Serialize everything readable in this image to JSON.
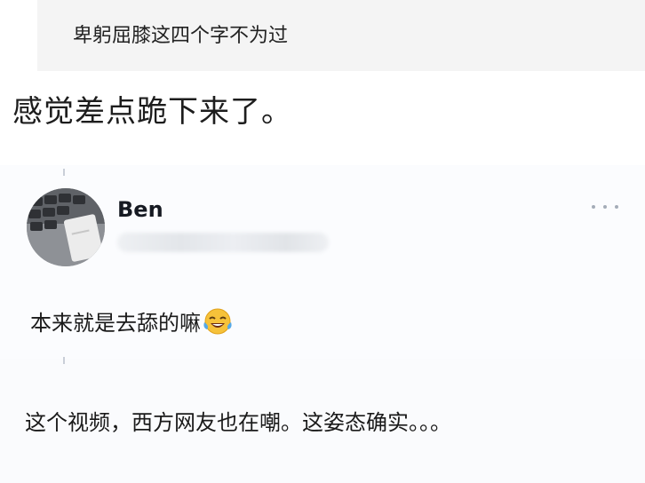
{
  "quote": {
    "text": "卑躬屈膝这四个字不为过"
  },
  "headline": {
    "text": "感觉差点跪下来了。"
  },
  "comment_card": {
    "username": "Ben",
    "comment_text": "本来就是去舔的嘛",
    "emoji": "face-with-tears-of-joy-icon",
    "more_icon": "more-dots-icon"
  },
  "reply": {
    "text": "这个视频，西方网友也在嘲。这姿态确实。。。"
  },
  "colors": {
    "card_background": "#fbfcfe",
    "thread_line": "#c9cfd8",
    "quote_background": "#f4f4f4"
  }
}
